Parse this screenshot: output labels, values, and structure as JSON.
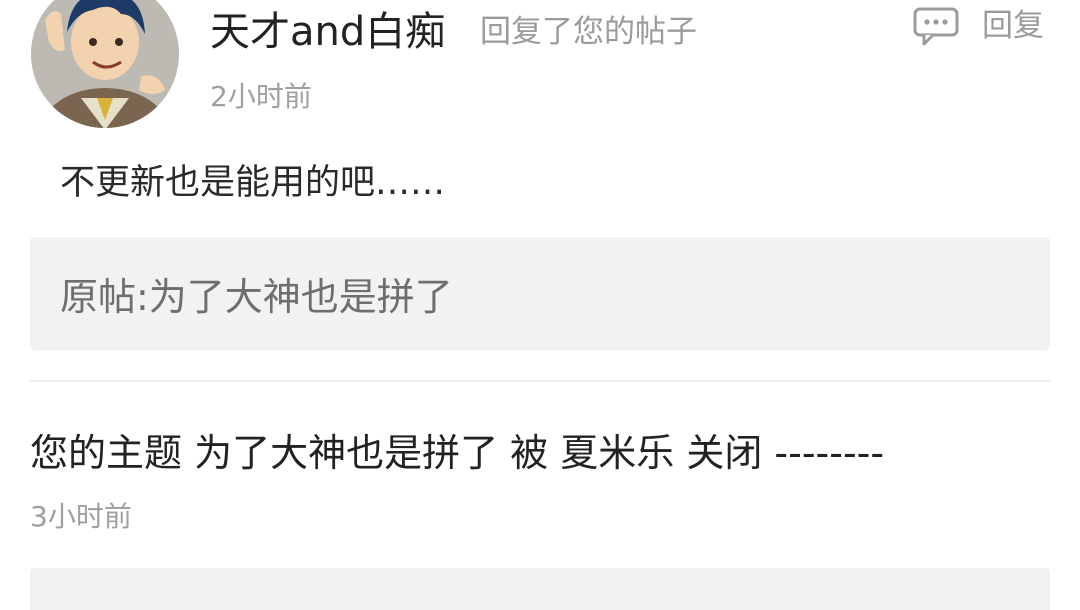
{
  "reply_item": {
    "username": "天才and白痴",
    "action": "回复了您的帖子",
    "reply_label": "回复",
    "time": "2小时前",
    "content": "不更新也是能用的吧……",
    "quote": "原帖:为了大神也是拼了"
  },
  "notice_item": {
    "text": "您的主题 为了大神也是拼了 被 夏米乐 关闭 --------",
    "time": "3小时前"
  },
  "colors": {
    "primary_text": "#222222",
    "secondary_text": "#9b9b9b",
    "quote_background": "#f2f2f2",
    "divider": "#ececec"
  },
  "icons": {
    "reply": "speech-bubble-icon",
    "avatar": "cartoon-character-avatar"
  }
}
